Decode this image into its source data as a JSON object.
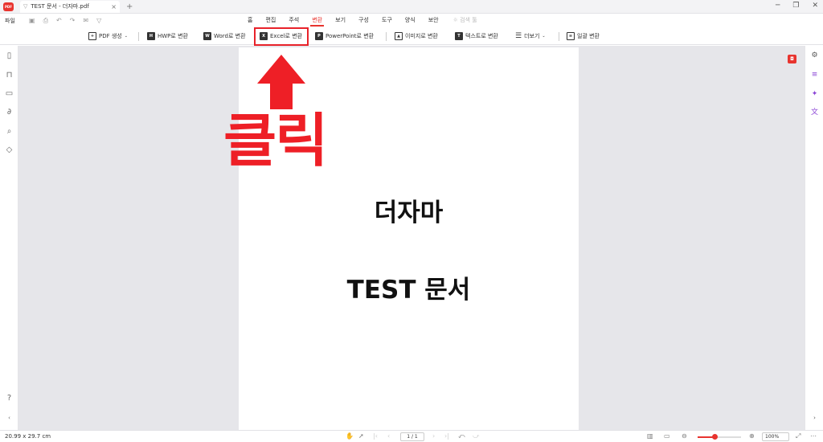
{
  "app": {
    "logo_text": "PDF",
    "tab_title": "TEST 문서 - 더자마.pdf"
  },
  "menu": {
    "file": "파일",
    "tabs": [
      "홈",
      "편집",
      "주석",
      "변환",
      "보기",
      "구성",
      "도구",
      "양식",
      "보안"
    ],
    "active_tab": "변환",
    "search_label": "검색 툴"
  },
  "ribbon": {
    "pdf_create": "PDF 생성",
    "hwp": "HWP로 변환",
    "word": "Word로 변환",
    "excel": "Excel로 변환",
    "powerpoint": "PowerPoint로 변환",
    "image": "이미지로 변환",
    "text": "텍스트로 변환",
    "more": "더보기",
    "batch": "일괄 변환"
  },
  "document": {
    "line1": "더자마",
    "line2": "TEST 문서"
  },
  "annotation": {
    "text": "클릭",
    "color": "#ee1f26"
  },
  "status": {
    "page_size": "20.99 x 29.7 cm",
    "page_indicator": "1 / 1",
    "zoom_label": "100%",
    "zoom_level": 0.38
  },
  "colors": {
    "accent": "#e8342f",
    "highlight": "#e8222a"
  }
}
